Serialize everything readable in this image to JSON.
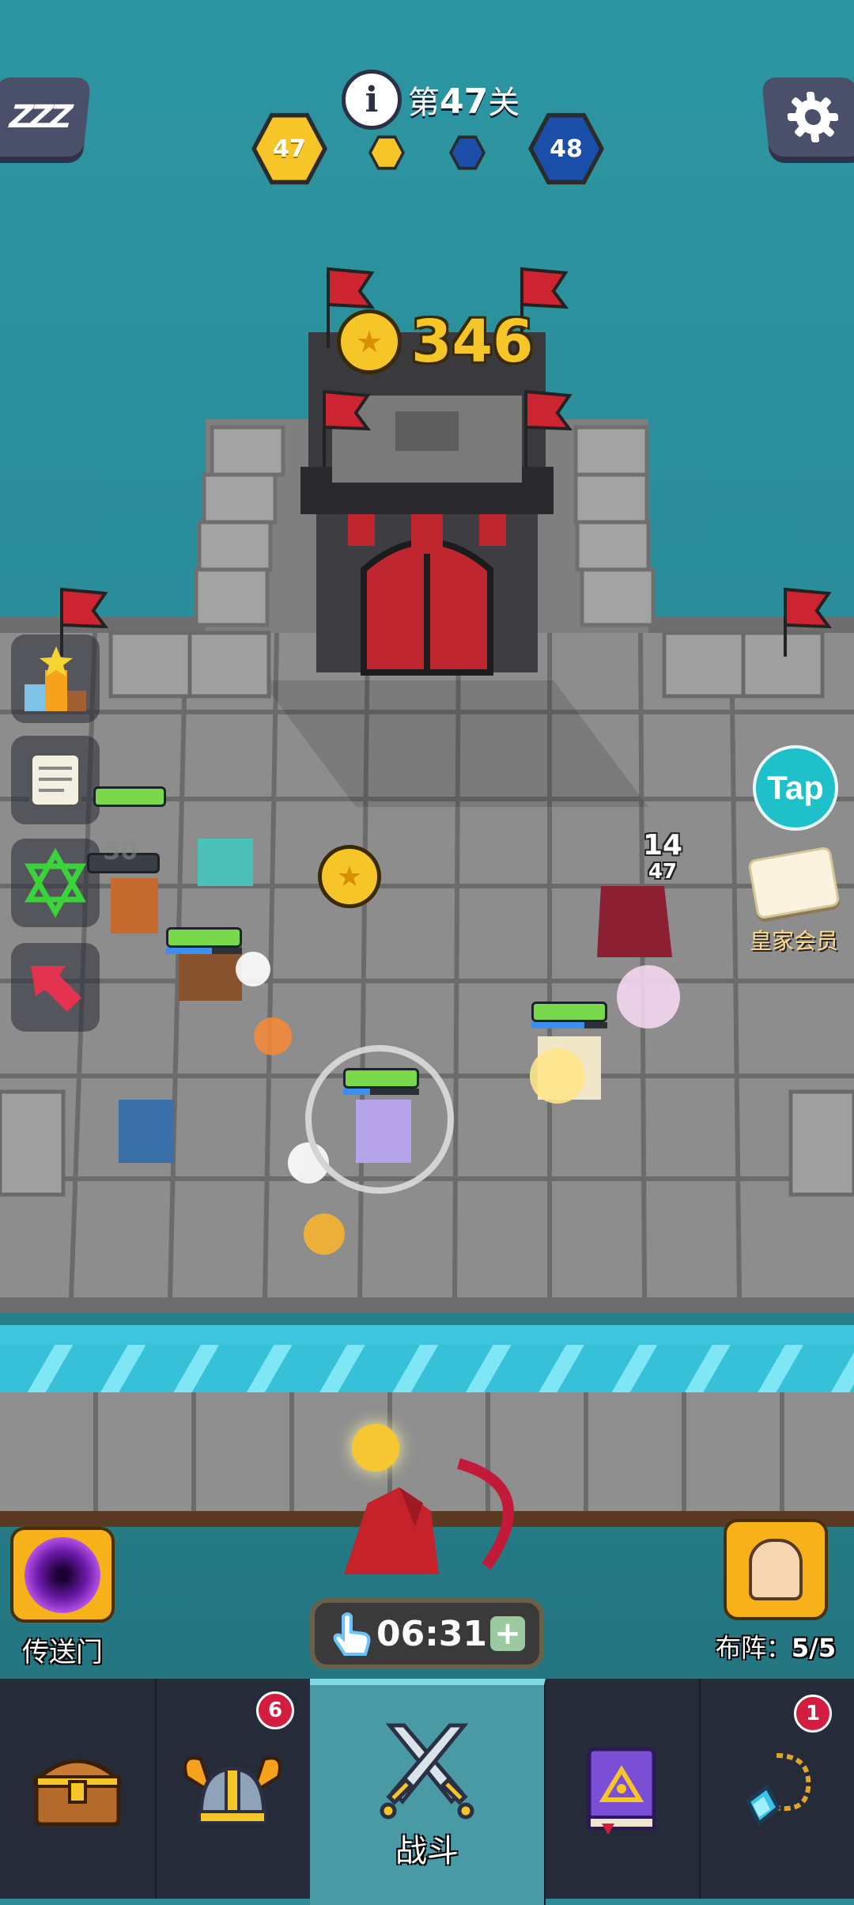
{
  "hud": {
    "level_prefix": "第",
    "level_number": "47",
    "level_suffix": "关",
    "left_score": "47",
    "right_score": "48",
    "sleep_label": "ZZZ"
  },
  "castle": {
    "coins": "346"
  },
  "battle": {
    "hp_ghost_value": "50",
    "damage_top": "14",
    "damage_bottom": "47"
  },
  "right_panel": {
    "tap_label": "Tap",
    "vip_label": "皇家会员"
  },
  "bottom_bar": {
    "portal_label": "传送门",
    "formation_label": "布阵：",
    "formation_value": "5/5",
    "timer": "06:31",
    "timer_add": "+"
  },
  "nav": {
    "items": [
      {
        "name": "chest",
        "label": "",
        "badge": ""
      },
      {
        "name": "heroes",
        "label": "",
        "badge": "6"
      },
      {
        "name": "battle",
        "label": "战斗",
        "badge": ""
      },
      {
        "name": "spellbook",
        "label": "",
        "badge": ""
      },
      {
        "name": "amulet",
        "label": "",
        "badge": "1"
      }
    ]
  },
  "colors": {
    "sea": "#2a8b97",
    "stone": "#8c8c8c",
    "flag_red": "#cc2430",
    "gold": "#f6c628",
    "blue_hex": "#1a4ea8",
    "nav_bg": "#262b3a",
    "nav_active": "#4a9aa5"
  }
}
